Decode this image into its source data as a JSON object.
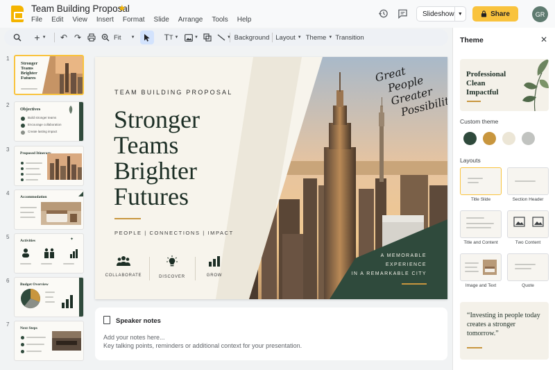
{
  "app": {
    "doc_title": "Team Building Proposal",
    "menu": [
      "File",
      "Edit",
      "View",
      "Insert",
      "Format",
      "Slide",
      "Arrange",
      "Tools",
      "Help"
    ],
    "slideshow_label": "Slideshow",
    "share_label": "Share",
    "avatar_initials": "GR",
    "accent_color": "#f9c33d"
  },
  "toolbar": {
    "zoom_label": "Fit",
    "background_label": "Background",
    "layout_label": "Layout",
    "theme_label": "Theme",
    "transition_label": "Transition"
  },
  "thumbnails": [
    {
      "num": "1",
      "title": "Stronger Teams Brighter Futures"
    },
    {
      "num": "2",
      "title": "Objectives",
      "items": [
        "Build stronger teams",
        "Encourage collaboration",
        "Create lasting impact"
      ]
    },
    {
      "num": "3",
      "title": "Proposed Itinerary"
    },
    {
      "num": "4",
      "title": "Accommodation"
    },
    {
      "num": "5",
      "title": "Activities"
    },
    {
      "num": "6",
      "title": "Budget Overview"
    },
    {
      "num": "7",
      "title": "Next Steps"
    }
  ],
  "slide": {
    "kicker": "TEAM BUILDING PROPOSAL",
    "headline": [
      "Stronger",
      "Teams",
      "Brighter",
      "Futures"
    ],
    "tagline": "PEOPLE   |   CONNECTIONS   |   IMPACT",
    "features": [
      {
        "label": "COLLABORATE",
        "icon": "people-icon"
      },
      {
        "label": "DISCOVER",
        "icon": "lightbulb-icon"
      },
      {
        "label": "GROW",
        "icon": "bar-chart-icon"
      }
    ],
    "script_lines": [
      "Great",
      "People",
      "Greater",
      "Possibilities"
    ],
    "memo_lines": [
      "A MEMORABLE",
      "EXPERIENCE",
      "IN A REMARKABLE CITY"
    ]
  },
  "notes": {
    "title": "Speaker notes",
    "placeholder_line1": "Add your notes here...",
    "placeholder_line2": "Key talking points, reminders or additional context for your presentation."
  },
  "panel": {
    "title": "Theme",
    "theme_card_text": "Professional\nClean\nImpactful",
    "custom_theme_label": "Custom theme",
    "swatches": [
      "#2f4a3c",
      "#c8963e",
      "#ece6d6",
      "#c1c3c0"
    ],
    "layouts_label": "Layouts",
    "layouts": [
      "Title Slide",
      "Section Header",
      "Title and Content",
      "Two Content",
      "Image and Text",
      "Quote"
    ],
    "quote": "“Investing in people today creates a stronger tomorrow.”"
  }
}
